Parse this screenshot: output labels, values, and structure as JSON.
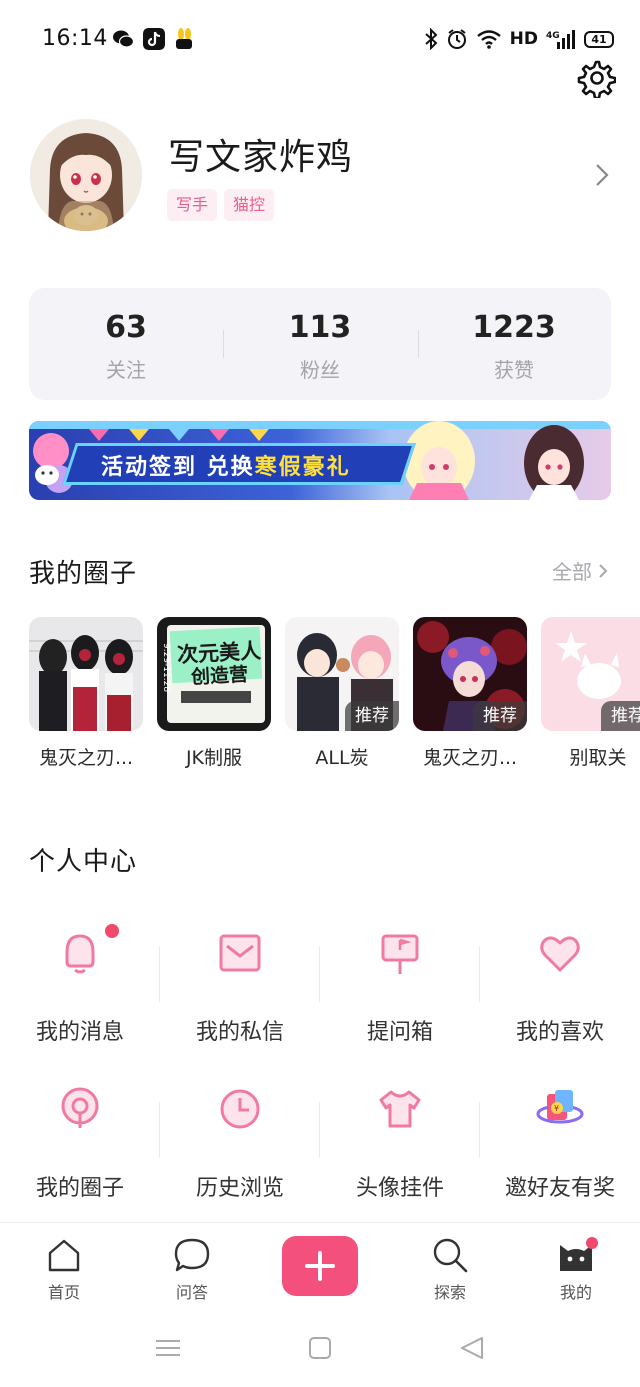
{
  "status_bar": {
    "time": "16:14",
    "network": "HD",
    "cellular": "4G",
    "battery": "41"
  },
  "profile": {
    "username": "写文家炸鸡",
    "tags": [
      "写手",
      "猫控"
    ]
  },
  "stats": [
    {
      "value": "63",
      "label": "关注"
    },
    {
      "value": "113",
      "label": "粉丝"
    },
    {
      "value": "1223",
      "label": "获赞"
    }
  ],
  "banner": {
    "text_main": "活动签到 兑换",
    "text_highlight": "寒假豪礼"
  },
  "circles": {
    "title": "我的圈子",
    "see_all": "全部",
    "items": [
      {
        "name": "鬼灭之刃...",
        "badge": ""
      },
      {
        "name": "JK制服",
        "badge": ""
      },
      {
        "name": "ALL炭",
        "badge": "推荐"
      },
      {
        "name": "鬼灭之刃...",
        "badge": "推荐"
      },
      {
        "name": "别取关",
        "badge": "推荐"
      }
    ],
    "jk_thumb_text": "次元美人",
    "jk_thumb_text2": "创造营",
    "jk_thumb_date": "9.29-11.28"
  },
  "personal_center": {
    "title": "个人中心",
    "items": [
      {
        "label": "我的消息",
        "icon": "bell-icon"
      },
      {
        "label": "我的私信",
        "icon": "mail-icon"
      },
      {
        "label": "提问箱",
        "icon": "mailbox-icon"
      },
      {
        "label": "我的喜欢",
        "icon": "heart-icon"
      },
      {
        "label": "我的圈子",
        "icon": "circle-pin-icon"
      },
      {
        "label": "历史浏览",
        "icon": "clock-icon"
      },
      {
        "label": "头像挂件",
        "icon": "tshirt-icon"
      },
      {
        "label": "邀好友有奖",
        "icon": "gift-icon"
      }
    ]
  },
  "bottom_nav": {
    "items": [
      {
        "label": "首页",
        "icon": "home-icon"
      },
      {
        "label": "问答",
        "icon": "chat-bubble-icon"
      },
      {
        "label": "探索",
        "icon": "search-icon"
      },
      {
        "label": "我的",
        "icon": "cat-icon"
      }
    ]
  },
  "colors": {
    "accent": "#f4507e",
    "tag_bg": "#fdeef3",
    "tag_text": "#ea5e8c",
    "card_bg": "#f4f4f8"
  }
}
